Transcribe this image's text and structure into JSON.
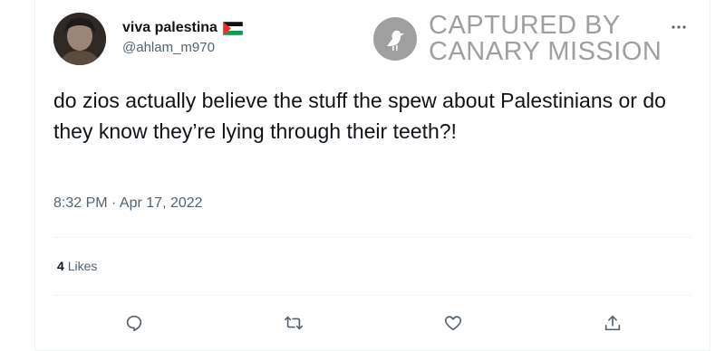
{
  "tweet": {
    "author": {
      "display_name": "viva palestina",
      "handle": "@ahlam_m970",
      "flag_icon": "palestine-flag-icon"
    },
    "text": "do zios actually believe the stuff the spew about Palestinians or do they know they’re lying through their teeth?!",
    "timestamp": "8:32 PM · Apr 17, 2022",
    "likes": {
      "count": "4",
      "label": "Likes"
    },
    "actions": [
      "reply-icon",
      "retweet-icon",
      "like-icon",
      "share-icon"
    ]
  },
  "watermark": {
    "line1": "CAPTURED BY",
    "line2": "CANARY MISSION",
    "logo_icon": "canary-bird-icon"
  },
  "colors": {
    "text_primary": "#0f1419",
    "text_secondary": "#536471",
    "watermark": "#9a9a9a"
  }
}
